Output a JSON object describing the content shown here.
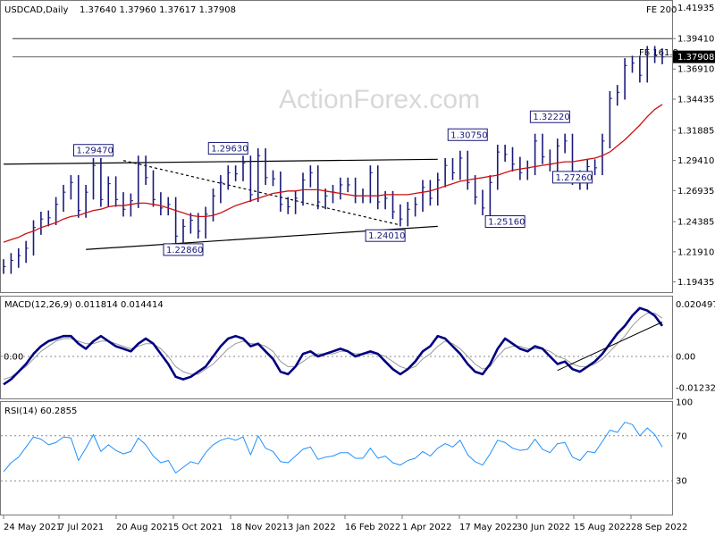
{
  "header": {
    "title": "USDCAD,Daily",
    "ohlc": "1.37640 1.37960 1.37617 1.37908",
    "fe200": "FE 200"
  },
  "watermark": "ActionForex.com",
  "colors": {
    "price": "#1a1a7a",
    "ma": "#cc1111",
    "macd": "#000080",
    "signal": "#999999",
    "rsi": "#1e90ff",
    "grid": "#888888"
  },
  "chart_data": [
    {
      "type": "candlestick",
      "title": "USDCAD,Daily",
      "price_ticks": [
        "1.41935",
        "1.39410",
        "1.36910",
        "1.34435",
        "1.31885",
        "1.29410",
        "1.26935",
        "1.24385",
        "1.21910",
        "1.19435"
      ],
      "price_tick_values": [
        1.41935,
        1.3941,
        1.3691,
        1.34435,
        1.31885,
        1.2941,
        1.26935,
        1.24385,
        1.2191,
        1.19435
      ],
      "ylim": [
        1.186,
        1.425
      ],
      "current_price": "1.37908",
      "x_labels": [
        "24 May 2021",
        "7 Jul 2021",
        "20 Aug 2021",
        "5 Oct 2021",
        "18 Nov 2021",
        "3 Jan 2022",
        "16 Feb 2022",
        "1 Apr 2022",
        "17 May 2022",
        "30 Jun 2022",
        "15 Aug 2022",
        "28 Sep 2022"
      ],
      "close": [
        1.207,
        1.212,
        1.216,
        1.222,
        1.239,
        1.246,
        1.247,
        1.258,
        1.268,
        1.276,
        1.253,
        1.268,
        1.29,
        1.262,
        1.275,
        1.262,
        1.254,
        1.261,
        1.292,
        1.28,
        1.262,
        1.255,
        1.258,
        1.232,
        1.24,
        1.245,
        1.236,
        1.25,
        1.265,
        1.276,
        1.284,
        1.283,
        1.292,
        1.266,
        1.298,
        1.28,
        1.279,
        1.258,
        1.256,
        1.263,
        1.278,
        1.284,
        1.26,
        1.265,
        1.268,
        1.274,
        1.274,
        1.265,
        1.265,
        1.284,
        1.26,
        1.263,
        1.252,
        1.246,
        1.254,
        1.258,
        1.272,
        1.263,
        1.278,
        1.29,
        1.284,
        1.296,
        1.276,
        1.264,
        1.255,
        1.276,
        1.301,
        1.299,
        1.291,
        1.284,
        1.288,
        1.31,
        1.297,
        1.291,
        1.306,
        1.31,
        1.28,
        1.276,
        1.289,
        1.288,
        1.31,
        1.345,
        1.35,
        1.372,
        1.374,
        1.364,
        1.382,
        1.38,
        1.379
      ],
      "moving_average": {
        "values": [
          1.227,
          1.229,
          1.231,
          1.234,
          1.236,
          1.239,
          1.241,
          1.243,
          1.246,
          1.248,
          1.249,
          1.251,
          1.253,
          1.254,
          1.256,
          1.257,
          1.257,
          1.258,
          1.259,
          1.259,
          1.258,
          1.257,
          1.255,
          1.253,
          1.251,
          1.249,
          1.248,
          1.248,
          1.249,
          1.251,
          1.254,
          1.257,
          1.259,
          1.261,
          1.263,
          1.265,
          1.267,
          1.268,
          1.269,
          1.269,
          1.27,
          1.27,
          1.27,
          1.269,
          1.268,
          1.267,
          1.266,
          1.265,
          1.265,
          1.265,
          1.265,
          1.266,
          1.266,
          1.266,
          1.266,
          1.267,
          1.268,
          1.269,
          1.271,
          1.273,
          1.275,
          1.277,
          1.278,
          1.279,
          1.28,
          1.281,
          1.282,
          1.284,
          1.286,
          1.287,
          1.288,
          1.289,
          1.29,
          1.291,
          1.292,
          1.293,
          1.293,
          1.294,
          1.295,
          1.296,
          1.298,
          1.301,
          1.306,
          1.311,
          1.317,
          1.323,
          1.33,
          1.336,
          1.34
        ]
      },
      "resistance_line": {
        "from": {
          "t": 0,
          "v": 1.291
        },
        "to": {
          "t": 58,
          "v": 1.295
        }
      },
      "support_line": {
        "from": {
          "t": 11,
          "v": 1.221
        },
        "to": {
          "t": 58,
          "v": 1.24
        }
      },
      "diagonal_line": {
        "from": {
          "t": 16,
          "v": 1.294
        },
        "to": {
          "t": 53,
          "v": 1.241
        }
      },
      "fe_line": {
        "v": 1.394
      },
      "level_line": {
        "v": 1.379
      },
      "annotations": [
        {
          "text": "1.29470",
          "t": 12,
          "v": 1.2947
        },
        {
          "text": "1.29630",
          "t": 30,
          "v": 1.2963
        },
        {
          "text": "1.22860",
          "t": 24,
          "v": 1.2286
        },
        {
          "text": "1.24010",
          "t": 51,
          "v": 1.2401
        },
        {
          "text": "1.30750",
          "t": 62,
          "v": 1.3075
        },
        {
          "text": "1.25160",
          "t": 67,
          "v": 1.2516
        },
        {
          "text": "1.32220",
          "t": 73,
          "v": 1.3222
        },
        {
          "text": "1.27260",
          "t": 76,
          "v": 1.2726
        }
      ],
      "fe_label": "FE 161.8"
    },
    {
      "type": "line",
      "title": "MACD(12,26,9) 0.011814 0.014414",
      "ticks": [
        "0.020497",
        "0.00",
        "-0.012325"
      ],
      "tick_values": [
        0.020497,
        0.0,
        -0.012325
      ],
      "ylim": [
        -0.0165,
        0.0235
      ],
      "zero_label": "0.00",
      "series": [
        {
          "values": [
            -0.011,
            -0.009,
            -0.006,
            -0.003,
            0.001,
            0.004,
            0.006,
            0.007,
            0.008,
            0.008,
            0.005,
            0.003,
            0.006,
            0.008,
            0.006,
            0.004,
            0.003,
            0.002,
            0.005,
            0.007,
            0.005,
            0.001,
            -0.003,
            -0.008,
            -0.009,
            -0.008,
            -0.006,
            -0.004,
            0.0,
            0.004,
            0.007,
            0.008,
            0.007,
            0.004,
            0.005,
            0.002,
            -0.001,
            -0.006,
            -0.007,
            -0.004,
            0.001,
            0.002,
            0.0,
            0.001,
            0.002,
            0.003,
            0.002,
            0.0,
            0.001,
            0.002,
            0.001,
            -0.002,
            -0.005,
            -0.007,
            -0.005,
            -0.002,
            0.002,
            0.004,
            0.008,
            0.007,
            0.004,
            0.001,
            -0.003,
            -0.006,
            -0.007,
            -0.003,
            0.003,
            0.007,
            0.005,
            0.003,
            0.002,
            0.004,
            0.003,
            0.0,
            -0.003,
            -0.002,
            -0.005,
            -0.006,
            -0.004,
            -0.002,
            0.001,
            0.005,
            0.009,
            0.012,
            0.016,
            0.019,
            0.018,
            0.016,
            0.012
          ]
        },
        {
          "values": [
            -0.009,
            -0.008,
            -0.006,
            -0.004,
            -0.001,
            0.002,
            0.004,
            0.006,
            0.007,
            0.007,
            0.006,
            0.005,
            0.005,
            0.006,
            0.006,
            0.005,
            0.004,
            0.003,
            0.004,
            0.005,
            0.005,
            0.003,
            0.0,
            -0.004,
            -0.006,
            -0.007,
            -0.007,
            -0.005,
            -0.003,
            0.0,
            0.003,
            0.005,
            0.006,
            0.005,
            0.005,
            0.004,
            0.002,
            -0.002,
            -0.004,
            -0.004,
            -0.002,
            0.0,
            0.001,
            0.001,
            0.001,
            0.002,
            0.002,
            0.001,
            0.001,
            0.001,
            0.001,
            0.0,
            -0.002,
            -0.004,
            -0.005,
            -0.004,
            -0.001,
            0.001,
            0.004,
            0.006,
            0.005,
            0.003,
            0.0,
            -0.003,
            -0.005,
            -0.004,
            0.0,
            0.003,
            0.004,
            0.004,
            0.003,
            0.003,
            0.003,
            0.002,
            0.0,
            -0.001,
            -0.003,
            -0.004,
            -0.004,
            -0.003,
            -0.001,
            0.002,
            0.005,
            0.008,
            0.012,
            0.015,
            0.017,
            0.017,
            0.015
          ]
        }
      ],
      "trend_line": {
        "from": {
          "t": 74,
          "v": -0.0055
        },
        "to": {
          "t": 88,
          "v": 0.0135
        }
      }
    },
    {
      "type": "line",
      "title": "RSI(14) 60.2855",
      "ticks": [
        "100",
        "70",
        "30"
      ],
      "tick_values": [
        100,
        70,
        30
      ],
      "ylim": [
        0,
        100
      ],
      "series": [
        {
          "values": [
            38,
            46,
            51,
            60,
            69,
            67,
            62,
            64,
            69,
            68,
            48,
            59,
            71,
            56,
            62,
            57,
            54,
            56,
            68,
            62,
            52,
            46,
            48,
            37,
            42,
            47,
            45,
            55,
            62,
            66,
            68,
            66,
            69,
            53,
            70,
            59,
            56,
            47,
            46,
            52,
            58,
            60,
            49,
            51,
            52,
            55,
            55,
            50,
            50,
            59,
            50,
            52,
            46,
            44,
            48,
            50,
            56,
            52,
            59,
            63,
            60,
            66,
            53,
            47,
            44,
            54,
            66,
            64,
            59,
            57,
            58,
            67,
            58,
            55,
            63,
            64,
            51,
            48,
            56,
            55,
            65,
            75,
            73,
            82,
            80,
            70,
            77,
            71,
            60
          ]
        }
      ]
    }
  ]
}
